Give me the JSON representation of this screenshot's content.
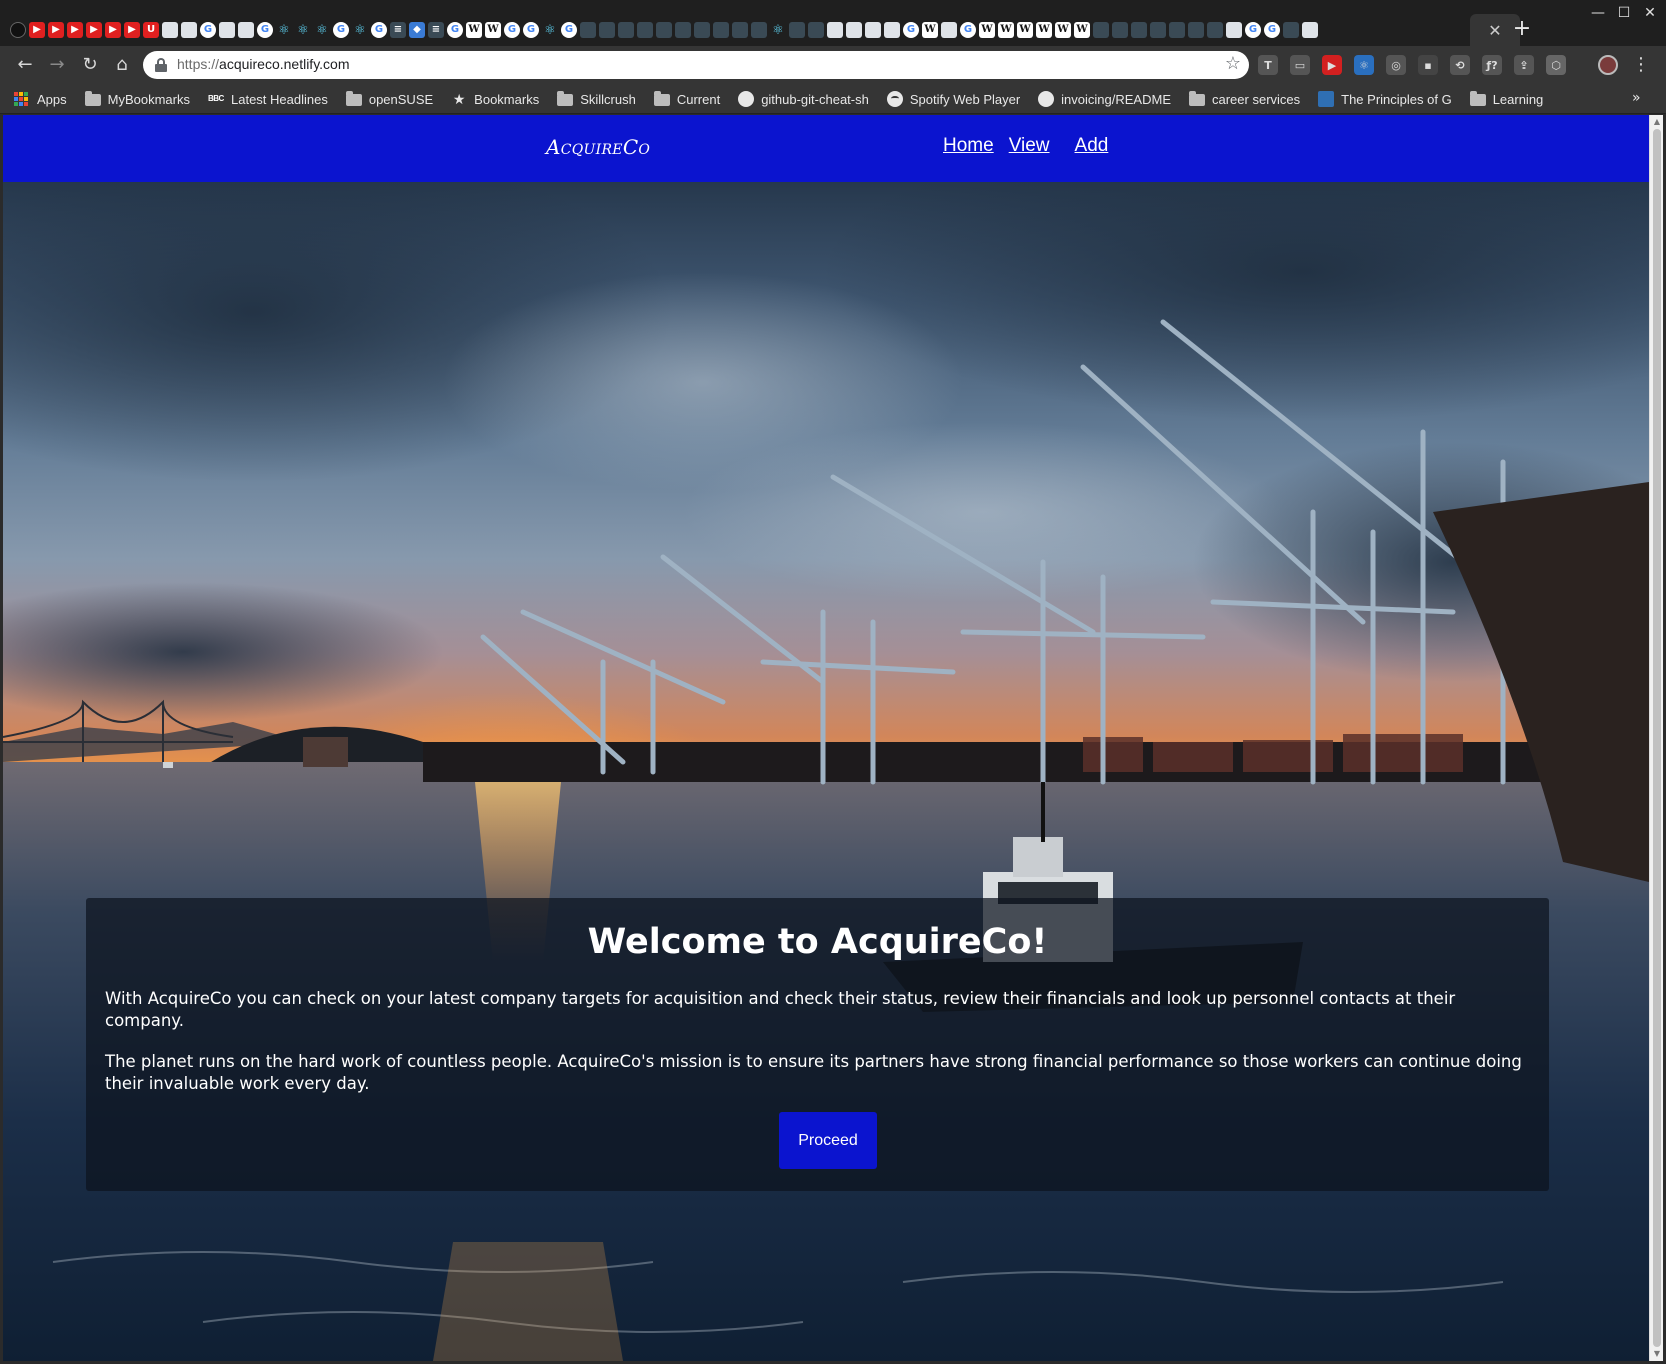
{
  "window": {
    "new_tab_symbol": "+",
    "close_tab_symbol": "✕",
    "controls": {
      "minimize": "—",
      "maximize": "☐",
      "close": "✕"
    },
    "favicon_strip": [
      "github",
      "youtube",
      "youtube",
      "youtube",
      "youtube",
      "youtube",
      "youtube",
      "udemy",
      "doc",
      "doc",
      "google",
      "doc",
      "doc",
      "google",
      "react",
      "react",
      "react",
      "google",
      "react",
      "google",
      "stackoverflow",
      "netlify",
      "stackoverflow",
      "google",
      "wikipedia",
      "wikipedia",
      "google",
      "google",
      "react",
      "google",
      "misc",
      "misc",
      "misc",
      "misc",
      "misc",
      "misc",
      "misc",
      "misc",
      "misc",
      "misc",
      "react",
      "misc",
      "misc",
      "doc",
      "doc",
      "doc",
      "doc",
      "google",
      "wikipedia",
      "doc",
      "google",
      "wikipedia",
      "wikipedia",
      "wikipedia",
      "wikipedia",
      "wikipedia",
      "wikipedia",
      "misc",
      "misc",
      "misc",
      "misc",
      "misc",
      "misc",
      "misc",
      "doc",
      "google",
      "google",
      "misc",
      "doc"
    ]
  },
  "toolbar": {
    "back": "←",
    "forward": "→",
    "reload": "↻",
    "home": "⌂",
    "url_scheme": "https://",
    "url_host": "acquireco.netlify.com",
    "star": "☆",
    "menu": "⋮",
    "extensions": [
      "T",
      "▭",
      "▶",
      "⚛",
      "◎",
      "▪",
      "⟲",
      "ƒ?",
      "⇪",
      "⬡"
    ]
  },
  "bookmarks": {
    "items": [
      {
        "icon": "apps-icon",
        "label": "Apps"
      },
      {
        "icon": "folder-icon",
        "label": "MyBookmarks"
      },
      {
        "icon": "bbc-icon",
        "label": "Latest Headlines"
      },
      {
        "icon": "folder-icon",
        "label": "openSUSE"
      },
      {
        "icon": "star-icon",
        "label": "Bookmarks"
      },
      {
        "icon": "folder-icon",
        "label": "Skillcrush"
      },
      {
        "icon": "folder-icon",
        "label": "Current"
      },
      {
        "icon": "github-icon",
        "label": "github-git-cheat-sh"
      },
      {
        "icon": "spotify-icon",
        "label": "Spotify Web Player"
      },
      {
        "icon": "github-icon",
        "label": "invoicing/README"
      },
      {
        "icon": "folder-icon",
        "label": "career services"
      },
      {
        "icon": "principles-icon",
        "label": "The Principles of G"
      },
      {
        "icon": "folder-icon",
        "label": "Learning"
      }
    ],
    "more": "»"
  },
  "site": {
    "brand": "AcquireCo",
    "nav": {
      "home": "Home",
      "view": "View",
      "add": "Add"
    },
    "colors": {
      "primary": "#0b14cf"
    },
    "welcome": {
      "title": "Welcome to AcquireCo!",
      "p1": "With AcquireCo you can check on your latest company targets for acquisition and check their status, review their financials and look up personnel contacts at their company.",
      "p2": "The planet runs on the hard work of countless people. AcquireCo's mission is to ensure its partners have strong financial performance so those workers can continue doing their invaluable work every day.",
      "button": "Proceed"
    }
  }
}
